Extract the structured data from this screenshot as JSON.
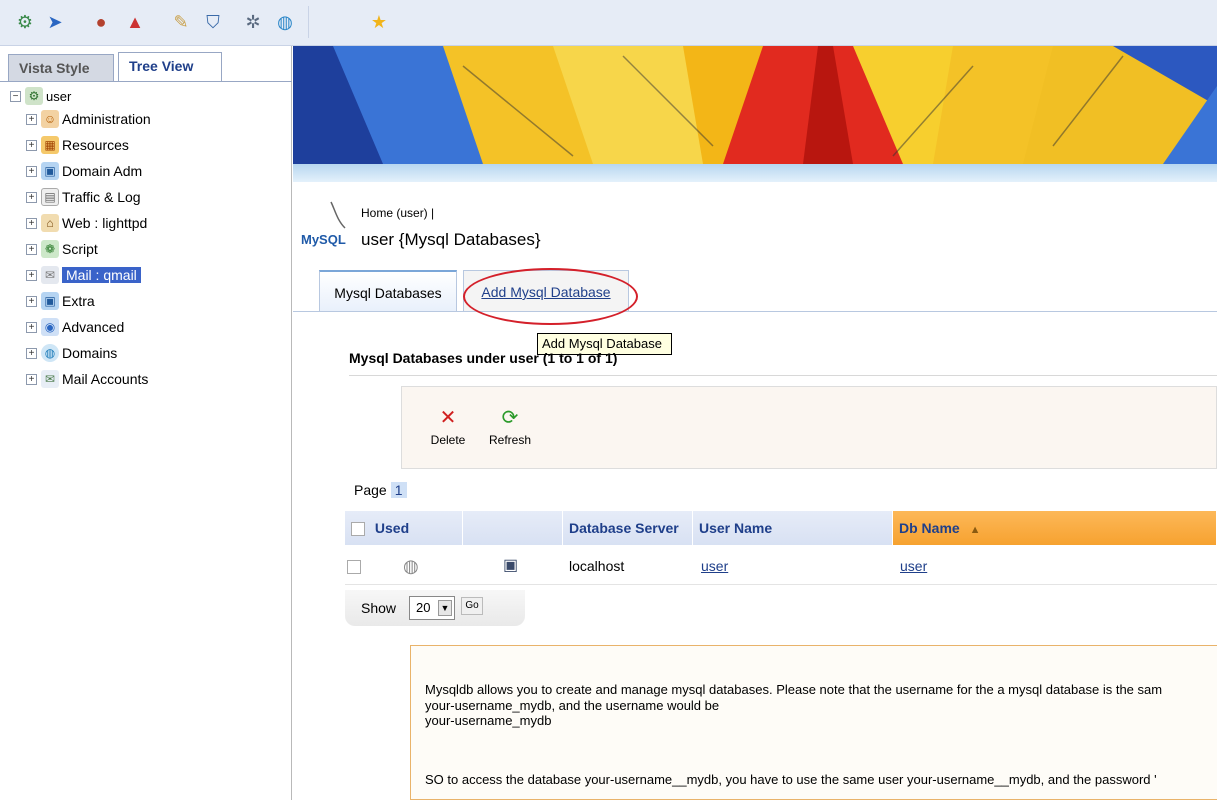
{
  "toolbar": {
    "icons": [
      "user-settings-icon",
      "send-icon",
      "account-icon",
      "upload-icon",
      "wizard-icon",
      "shield-icon",
      "gears-icon",
      "globe-icon",
      "favorites-star-icon"
    ]
  },
  "sidebar": {
    "tabs": [
      {
        "label": "Vista Style",
        "active": false
      },
      {
        "label": "Tree View",
        "active": true
      }
    ],
    "root": "user",
    "items": [
      {
        "label": "Administration",
        "icon": "admin-icon"
      },
      {
        "label": "Resources",
        "icon": "resources-icon"
      },
      {
        "label": "Domain Adm",
        "icon": "domain-adm-icon"
      },
      {
        "label": "Traffic & Log",
        "icon": "traffic-log-icon"
      },
      {
        "label": "Web : lighttpd",
        "icon": "web-icon"
      },
      {
        "label": "Script",
        "icon": "script-icon"
      },
      {
        "label": "Mail : qmail",
        "icon": "mail-icon",
        "selected": true
      },
      {
        "label": "Extra",
        "icon": "extra-icon"
      },
      {
        "label": "Advanced",
        "icon": "advanced-icon"
      },
      {
        "label": "Domains",
        "icon": "domains-icon"
      },
      {
        "label": "Mail Accounts",
        "icon": "mail-accounts-icon"
      }
    ]
  },
  "header": {
    "breadcrumb": "Home (user)  |",
    "logo_text": "MySQL",
    "title": "user {Mysql Databases}"
  },
  "tabs": {
    "mysql_databases": "Mysql Databases",
    "add_mysql_database": "Add Mysql Database"
  },
  "tooltip": "Add Mysql Database",
  "list": {
    "heading": "Mysql Databases under user (1 to 1 of 1)"
  },
  "actions": {
    "delete": "Delete",
    "refresh": "Refresh"
  },
  "pager": {
    "label": "Page",
    "current": "1"
  },
  "grid": {
    "columns": [
      "Used",
      "",
      "Database Server",
      "User Name",
      "Db Name"
    ],
    "sort_indicator": "▲",
    "rows": [
      {
        "server": "localhost",
        "user_name": "user",
        "db_name": "user"
      }
    ]
  },
  "show": {
    "label": "Show",
    "value": "20",
    "go": "Go"
  },
  "info": {
    "line1": "Mysqldb allows you to create and manage mysql databases. Please note that the username for the a mysql database is the sam",
    "line2": "your-username_mydb, and the username would be",
    "line3": "your-username_mydb",
    "line4": "SO to access the database your-username__mydb, you have to use the same user your-username__mydb, and the password '"
  },
  "colors": {
    "accent": "#1f3f8a",
    "selection": "#3a63c9",
    "sorted_header": "#f6a230",
    "highlight_ellipse": "#d4202a",
    "tooltip_bg": "#ffffe1"
  }
}
